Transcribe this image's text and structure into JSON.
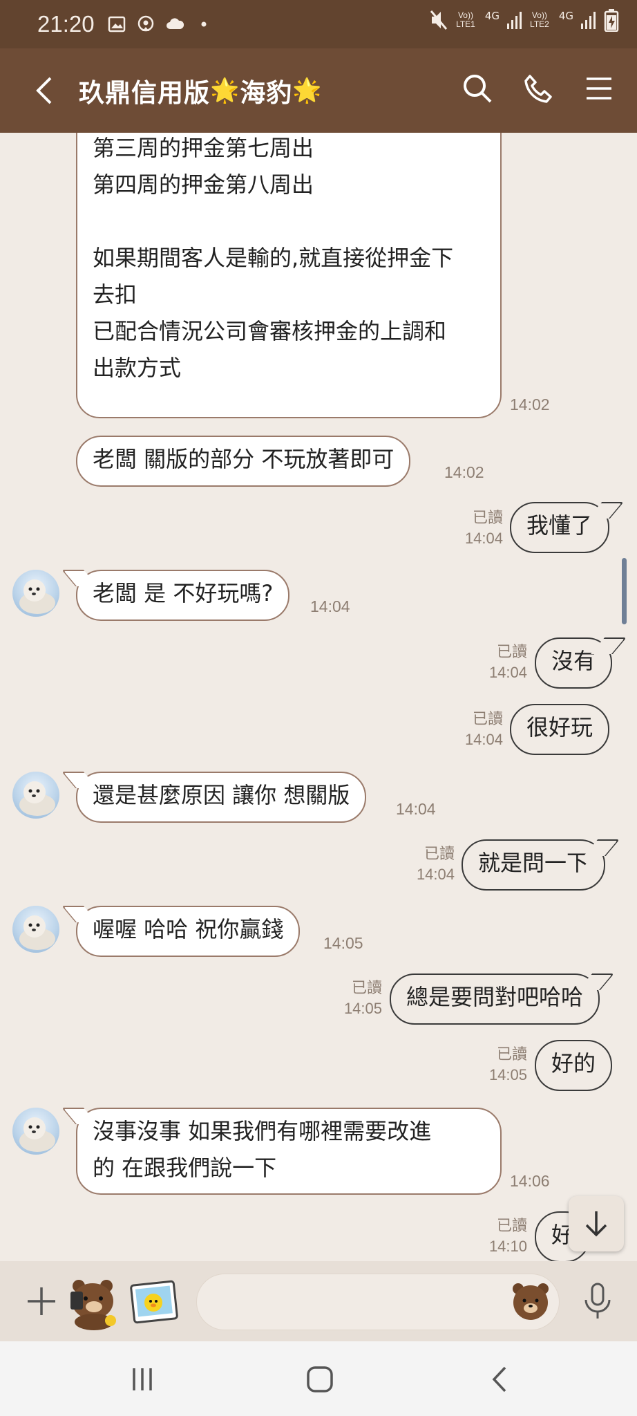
{
  "status_bar": {
    "time": "21:20",
    "sim1": {
      "volte": "Vo))",
      "lte": "LTE1",
      "gen": "4G"
    },
    "sim2": {
      "volte": "Vo))",
      "lte": "LTE2",
      "gen": "4G"
    },
    "icons": [
      "gallery-icon",
      "map-pin-icon",
      "cloud-icon",
      "dot-icon",
      "mute-icon",
      "signal-icon",
      "battery-charging-icon"
    ]
  },
  "header": {
    "title": "玖鼎信用版",
    "title_suffix": "海豹",
    "title_emoji": "🌟"
  },
  "messages": [
    {
      "sender": "other",
      "lines": [
        "第三周的押金第七周出",
        "第四周的押金第八周出",
        "",
        "如果期間客人是輸的,就直接從押金下",
        "去扣",
        "已配合情況公司會審核押金的上調和",
        "出款方式"
      ],
      "time": "14:02"
    },
    {
      "sender": "other",
      "text": "老闆 關版的部分 不玩放著即可",
      "time": "14:02"
    },
    {
      "sender": "me",
      "text": "我懂了",
      "read": "已讀",
      "time": "14:04"
    },
    {
      "sender": "other",
      "text": "老闆 是 不好玩嗎?",
      "time": "14:04"
    },
    {
      "sender": "me",
      "text": "沒有",
      "read": "已讀",
      "time": "14:04"
    },
    {
      "sender": "me",
      "text": "很好玩",
      "read": "已讀",
      "time": "14:04"
    },
    {
      "sender": "other",
      "text": "還是甚麼原因 讓你 想關版",
      "time": "14:04"
    },
    {
      "sender": "me",
      "text": "就是問一下",
      "read": "已讀",
      "time": "14:04"
    },
    {
      "sender": "other",
      "text": "喔喔 哈哈 祝你贏錢",
      "time": "14:05"
    },
    {
      "sender": "me",
      "text": "總是要問對吧哈哈",
      "read": "已讀",
      "time": "14:05"
    },
    {
      "sender": "me",
      "text": "好的",
      "read": "已讀",
      "time": "14:05"
    },
    {
      "sender": "other",
      "lines": [
        "沒事沒事  如果我們有哪裡需要改進",
        "的 在跟我們說一下"
      ],
      "time": "14:06"
    },
    {
      "sender": "me",
      "text": "好",
      "read": "已讀",
      "time": "14:10"
    }
  ],
  "input": {
    "value": "",
    "placeholder": ""
  },
  "colors": {
    "status_bar": "#62442f",
    "header": "#6e4c36",
    "chat_bg": "#f1ebe5",
    "input_bar": "#e7dfd7"
  }
}
